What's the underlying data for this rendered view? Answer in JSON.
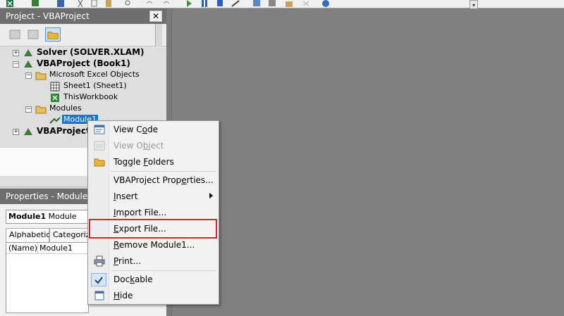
{
  "toolbar": {
    "icons": [
      "excel-icon",
      "insert-icon",
      "save-icon",
      "cut-icon",
      "copy-icon",
      "paste-icon",
      "find-icon",
      "undo-icon",
      "redo-icon",
      "run-icon",
      "break-icon",
      "reset-icon",
      "design-mode-icon",
      "project-explorer-icon",
      "properties-icon",
      "object-browser-icon",
      "toolbox-icon",
      "help-icon"
    ]
  },
  "project_panel": {
    "title": "Project - VBAProject",
    "close_glyph": "✕",
    "tree": [
      {
        "label": "Solver (SOLVER.XLAM)",
        "bold": true,
        "expander": "+"
      },
      {
        "label": "VBAProject (Book1)",
        "bold": true,
        "expander": "−"
      },
      {
        "label": "Microsoft Excel Objects",
        "bold": false,
        "expander": "−"
      },
      {
        "label": "Sheet1 (Sheet1)",
        "bold": false
      },
      {
        "label": "ThisWorkbook",
        "bold": false
      },
      {
        "label": "Modules",
        "bold": false,
        "expander": "−"
      },
      {
        "label": "Module1",
        "bold": false,
        "selected": true
      },
      {
        "label": "VBAProject (",
        "bold": true,
        "expander": "+"
      }
    ]
  },
  "properties_panel": {
    "title": "Properties - Module1",
    "object_name": "Module1",
    "object_type": "Module",
    "tabs": [
      "Alphabetic",
      "Categoriz"
    ],
    "rows": [
      {
        "key": "(Name)",
        "value": "Module1"
      }
    ]
  },
  "context_menu": {
    "items": [
      {
        "pre": "View C",
        "u": "o",
        "post": "de",
        "icon": "view-code-icon",
        "enabled": true
      },
      {
        "pre": "View O",
        "u": "b",
        "post": "ject",
        "icon": "view-object-icon",
        "enabled": false
      },
      {
        "pre": "Toggle ",
        "u": "F",
        "post": "olders",
        "icon": "folder-icon",
        "enabled": true
      },
      {
        "pre": "VBAProject Prop",
        "u": "e",
        "post": "rties...",
        "icon": "",
        "enabled": true
      },
      {
        "pre": "",
        "u": "I",
        "post": "nsert",
        "icon": "",
        "enabled": true,
        "submenu": true
      },
      {
        "pre": "",
        "u": "I",
        "post": "mport File...",
        "icon": "",
        "enabled": true
      },
      {
        "pre": "",
        "u": "E",
        "post": "xport File...",
        "icon": "",
        "enabled": true,
        "highlighted": true
      },
      {
        "pre": "",
        "u": "R",
        "post": "emove Module1...",
        "icon": "",
        "enabled": true
      },
      {
        "pre": "",
        "u": "P",
        "post": "rint...",
        "icon": "print-icon",
        "enabled": true
      },
      {
        "pre": "Doc",
        "u": "k",
        "post": "able",
        "icon": "checkmark-icon",
        "enabled": true,
        "checked": true
      },
      {
        "pre": "",
        "u": "H",
        "post": "ide",
        "icon": "hide-icon",
        "enabled": true
      }
    ]
  },
  "colors": {
    "selection": "#1874d2",
    "highlight_border": "#d4262c",
    "panel_header": "#6e6e6e",
    "workspace": "#808080"
  }
}
